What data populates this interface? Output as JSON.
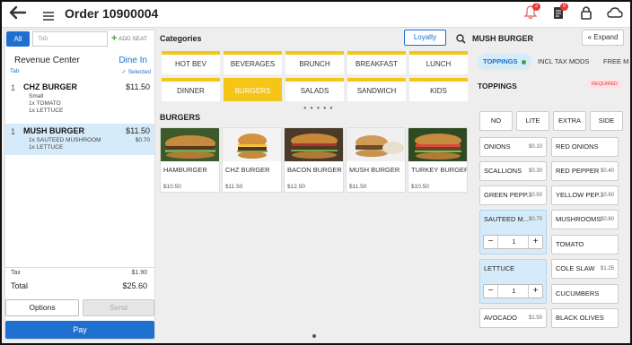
{
  "header": {
    "title": "Order 10900004",
    "notif_count": "2",
    "orders_count": "0"
  },
  "left": {
    "tab_all": "All",
    "tab_placeholder": "Tab",
    "add_seat": "ADD SEAT",
    "revenue_center": "Revenue Center",
    "dine_in": "Dine In",
    "tab_label": "Tab",
    "selected": "Selected",
    "items": [
      {
        "qty": "1",
        "name": "CHZ BURGER",
        "price": "$11.50",
        "subs": [
          {
            "text": "Small"
          },
          {
            "text": "1x  TOMATO"
          },
          {
            "text": "1x  LETTUCE"
          }
        ]
      },
      {
        "qty": "1",
        "name": "MUSH BURGER",
        "price": "$11.50",
        "subs": [
          {
            "text": "1x  SAUTEED MUSHROOM",
            "price": "$0.70"
          },
          {
            "text": "1x  LETTUCE"
          }
        ]
      }
    ],
    "tax_label": "Tax",
    "tax": "$1.90",
    "total_label": "Total",
    "total": "$25.60",
    "options": "Options",
    "send": "Send",
    "pay": "Pay"
  },
  "middle": {
    "categories_label": "Categories",
    "loyalty": "Loyalty",
    "categories": [
      "HOT BEV",
      "BEVERAGES",
      "BRUNCH",
      "BREAKFAST",
      "LUNCH",
      "DINNER",
      "BURGERS",
      "SALADS",
      "SANDWICH",
      "KIDS"
    ],
    "selected_category": "BURGERS",
    "section": "BURGERS",
    "products": [
      {
        "name": "HAMBURGER",
        "price": "$10.50"
      },
      {
        "name": "CHZ BURGER",
        "price": "$11.50"
      },
      {
        "name": "BACON BURGER",
        "price": "$12.50"
      },
      {
        "name": "MUSH BURGER",
        "price": "$11.50"
      },
      {
        "name": "TURKEY BURGER",
        "price": "$10.50"
      }
    ]
  },
  "right": {
    "item_title": "MUSH BURGER",
    "expand": "Expand",
    "tabs": [
      "TOPPINGS",
      "INCL TAX MODS",
      "FREE M"
    ],
    "section": "TOPPINGS",
    "required": "REQUIRED",
    "portions": [
      "NO",
      "LITE",
      "EXTRA",
      "SIDE"
    ],
    "mods": [
      {
        "name": "ONIONS",
        "price": "$0.10"
      },
      {
        "name": "RED ONIONS",
        "price": ""
      },
      {
        "name": "SCALLIONS",
        "price": "$0.30"
      },
      {
        "name": "RED PEPPER",
        "price": "$0.40"
      },
      {
        "name": "GREEN PEPP...",
        "price": "$0.50"
      },
      {
        "name": "YELLOW PEP...",
        "price": "$0.60"
      },
      {
        "name": "SAUTEED M...",
        "price": "$0.70",
        "qty": "1"
      },
      {
        "name": "MUSHROOMS",
        "price": "$0.80"
      },
      {
        "name": "TOMATO",
        "price": ""
      },
      {
        "name": "LETTUCE",
        "price": "",
        "qty": "1"
      },
      {
        "name": "COLE SLAW",
        "price": "$1.25"
      },
      {
        "name": "CUCUMBERS",
        "price": ""
      },
      {
        "name": "AVOCADO",
        "price": "$1.50"
      },
      {
        "name": "BLACK OLIVES",
        "price": ""
      }
    ]
  },
  "colors": {
    "accent": "#1e6fcf",
    "category_yellow": "#f5c518",
    "selected_bg": "#d6ebfa"
  }
}
